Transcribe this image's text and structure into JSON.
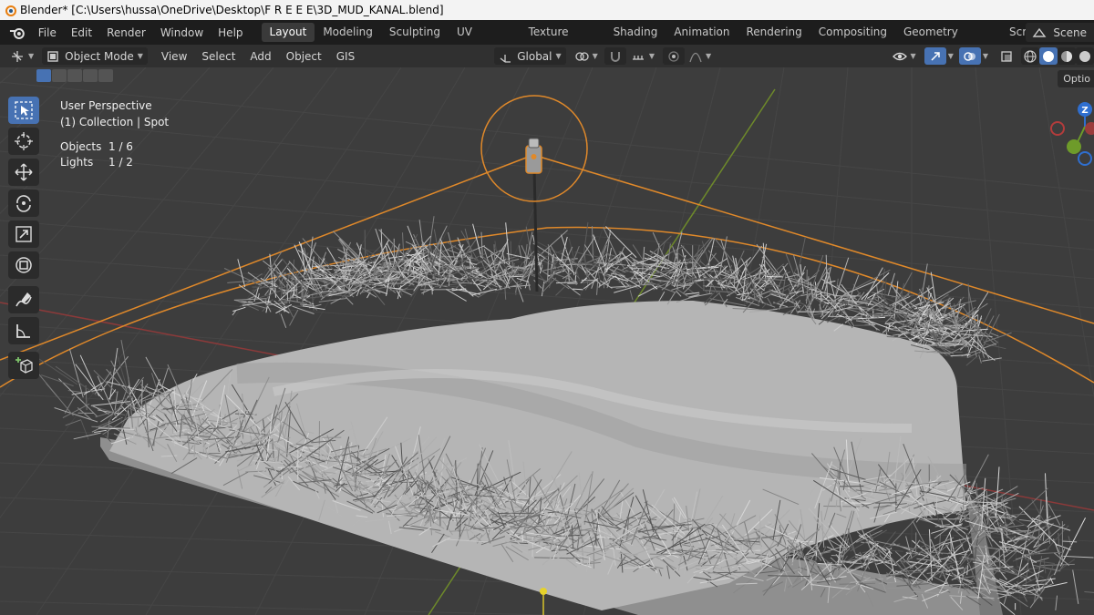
{
  "window": {
    "title": "Blender* [C:\\Users\\hussa\\OneDrive\\Desktop\\F R E E E\\3D_MUD_KANAL.blend]"
  },
  "menu": [
    "File",
    "Edit",
    "Render",
    "Window",
    "Help"
  ],
  "workspaces": [
    "Layout",
    "Modeling",
    "Sculpting",
    "UV Editing",
    "Texture Paint",
    "Shading",
    "Animation",
    "Rendering",
    "Compositing",
    "Geometry Nodes",
    "Scripting"
  ],
  "active_workspace": "Layout",
  "scene": {
    "label": "Scene"
  },
  "header": {
    "mode": "Object Mode",
    "menus": [
      "View",
      "Select",
      "Add",
      "Object",
      "GIS"
    ],
    "orientation": "Global"
  },
  "viewport": {
    "perspective": "User Perspective",
    "collection": "(1) Collection | Spot",
    "objects_label": "Objects",
    "objects_value": "1 / 6",
    "lights_label": "Lights",
    "lights_value": "1 / 2"
  },
  "options_tab": "Optio",
  "gizmo": {
    "z_label": "Z"
  },
  "colors": {
    "accent": "#4772b3",
    "selection": "#e0892a",
    "x_axis": "#b33c3c",
    "y_axis": "#6e9b2a",
    "z_axis": "#2f6fd0"
  },
  "icons": [
    "blender-logo-icon",
    "select-box-icon",
    "cursor-icon",
    "move-icon",
    "rotate-icon",
    "scale-icon",
    "transform-icon",
    "annotate-icon",
    "measure-icon",
    "add-cube-icon"
  ]
}
